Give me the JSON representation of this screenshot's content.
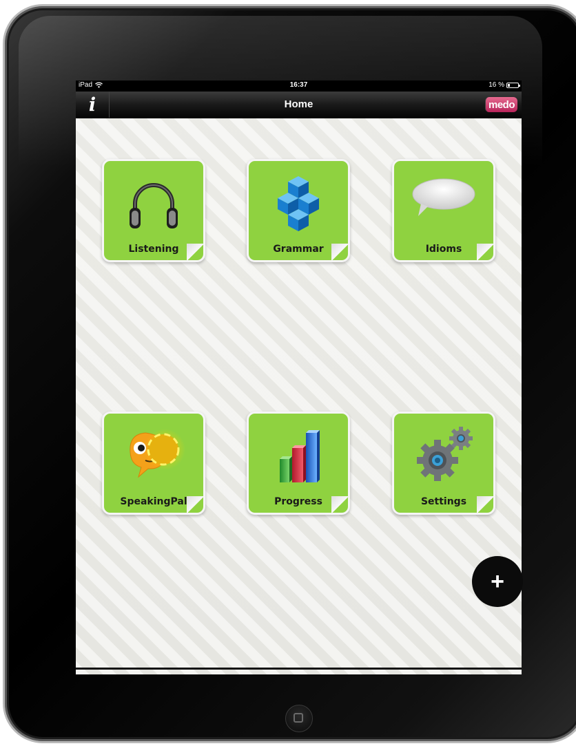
{
  "status_bar": {
    "device": "iPad",
    "time": "16:37",
    "battery": "16 %"
  },
  "nav_bar": {
    "info_label": "i",
    "title": "Home",
    "logo_text": "medo"
  },
  "tiles": [
    {
      "label": "Listening",
      "icon": "headphones-icon"
    },
    {
      "label": "Grammar",
      "icon": "cubes-icon"
    },
    {
      "label": "Idioms",
      "icon": "speech-bubble-icon"
    },
    {
      "label": "SpeakingPal",
      "icon": "speakingpal-icon"
    },
    {
      "label": "Progress",
      "icon": "bar-chart-icon"
    },
    {
      "label": "Settings",
      "icon": "gears-icon"
    }
  ],
  "fab": {
    "label": "+"
  },
  "colors": {
    "tile_green": "#8fd240",
    "accent_blue": "#2e6fd0",
    "logo_pink": "#c93a6c"
  }
}
